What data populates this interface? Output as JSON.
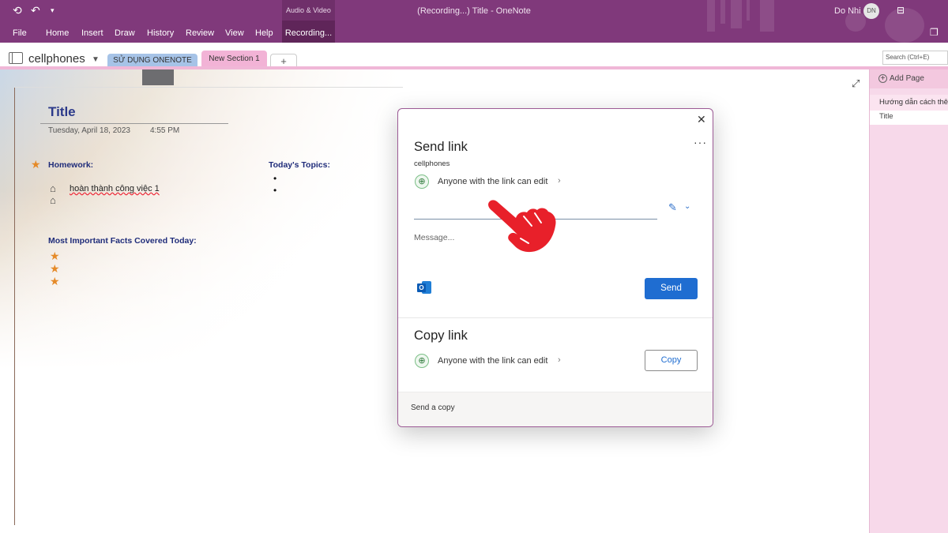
{
  "titlebar": {
    "window_title": "(Recording...) Title  -  OneNote",
    "user_name": "Do Nhi",
    "avatar_initials": "DN",
    "contextual_group": "Audio & Video"
  },
  "ribbon": {
    "tabs": [
      "File",
      "Home",
      "Insert",
      "Draw",
      "History",
      "Review",
      "View",
      "Help"
    ],
    "active_tab": "Recording..."
  },
  "notebook": {
    "name": "cellphones",
    "sections": [
      "SỬ DỤNG ONENOTE",
      "New Section 1"
    ],
    "add_tab": "+",
    "search_placeholder": "Search (Ctrl+E)"
  },
  "page": {
    "title": "Title",
    "date": "Tuesday, April 18, 2023",
    "time": "4:55 PM",
    "homework_heading": "Homework:",
    "homework_item": "hoàn thành công việc 1",
    "topics_heading": "Today's Topics:",
    "facts_heading": "Most Important Facts Covered Today:"
  },
  "pages_pane": {
    "add_page": "Add Page",
    "pages": [
      "Hướng dẫn cách thê",
      "Title"
    ]
  },
  "share_dialog": {
    "send_title": "Send link",
    "notebook_label": "cellphones",
    "permission": "Anyone with the link can edit",
    "message_placeholder": "Message...",
    "send_button": "Send",
    "copy_title": "Copy link",
    "copy_button": "Copy",
    "footer": "Send a copy"
  },
  "colors": {
    "onenote_purple": "#80397b",
    "section_blue": "#a6c3e7",
    "section_pink": "#f2b3d6",
    "send_blue": "#1f6dd1",
    "hand_red": "#e8202a"
  }
}
